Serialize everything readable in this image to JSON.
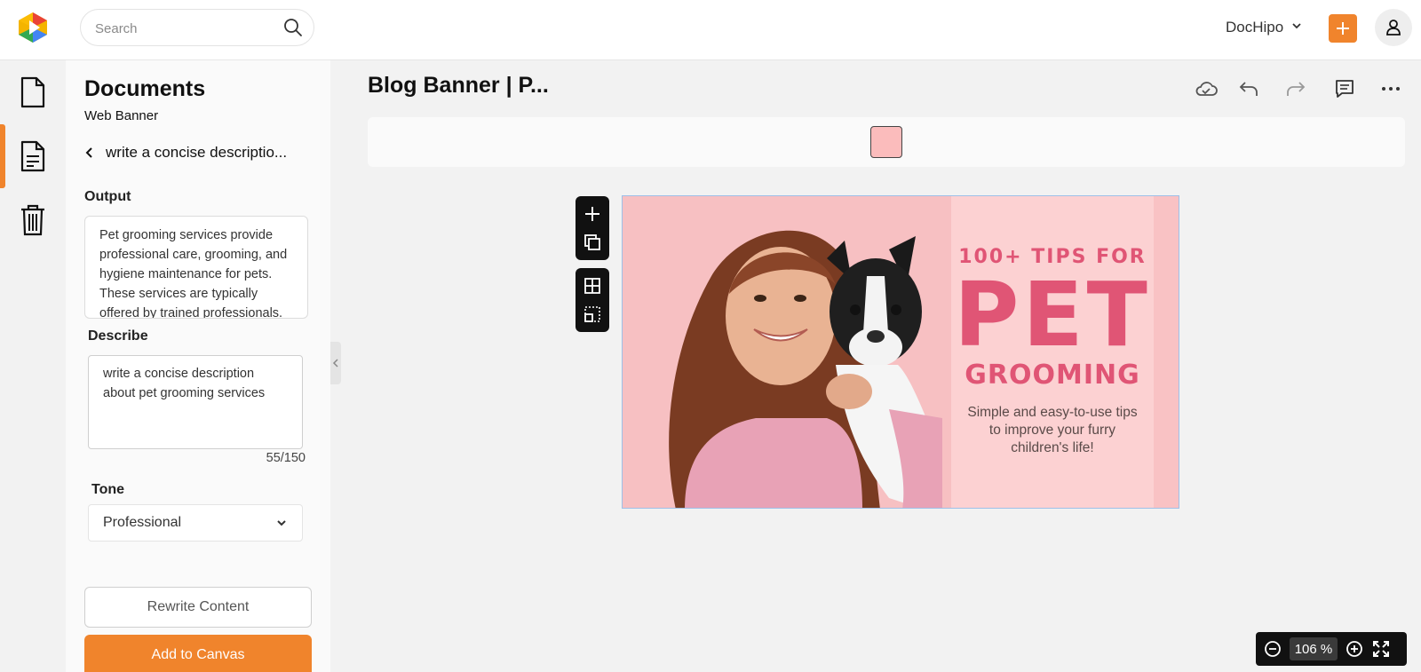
{
  "header": {
    "search_placeholder": "Search",
    "account_name": "DocHipo",
    "icons": [
      "search-icon",
      "chevron-down-icon",
      "plus-icon",
      "user-icon"
    ],
    "accent_color": "#f0842c"
  },
  "rail": {
    "items": [
      {
        "name": "document",
        "icon": "document-icon",
        "active": false
      },
      {
        "name": "text-document",
        "icon": "text-document-icon",
        "active": true
      },
      {
        "name": "trash",
        "icon": "trash-icon",
        "active": false
      }
    ]
  },
  "panel": {
    "title": "Documents",
    "subtitle": "Web Banner",
    "back_label": "write a concise descriptio...",
    "output_label": "Output",
    "output_text": "Pet grooming services provide professional care, grooming, and hygiene maintenance for pets. These services are typically offered by trained professionals.",
    "describe_label": "Describe",
    "describe_value": "write a concise description about pet grooming services",
    "char_count": "55/150",
    "tone_label": "Tone",
    "tone_value": "Professional",
    "rewrite_button": "Rewrite Content",
    "add_button": "Add to Canvas"
  },
  "canvas": {
    "doc_title": "Blog Banner | P...",
    "toolbar_icons": [
      "cloud-save-icon",
      "undo-icon",
      "redo-icon",
      "comment-icon",
      "more-icon"
    ],
    "swatch_color": "#fbbcbc",
    "float_tools": [
      "add-icon",
      "duplicate-icon",
      "grid-icon",
      "select-area-icon"
    ],
    "banner": {
      "tips": "100+ TIPS FOR",
      "pet": "PET",
      "grooming": "GROOMING",
      "description": "Simple and easy-to-use tips to improve your furry children's life!",
      "text_color": "#e05575"
    },
    "zoom_value": "106 %"
  }
}
